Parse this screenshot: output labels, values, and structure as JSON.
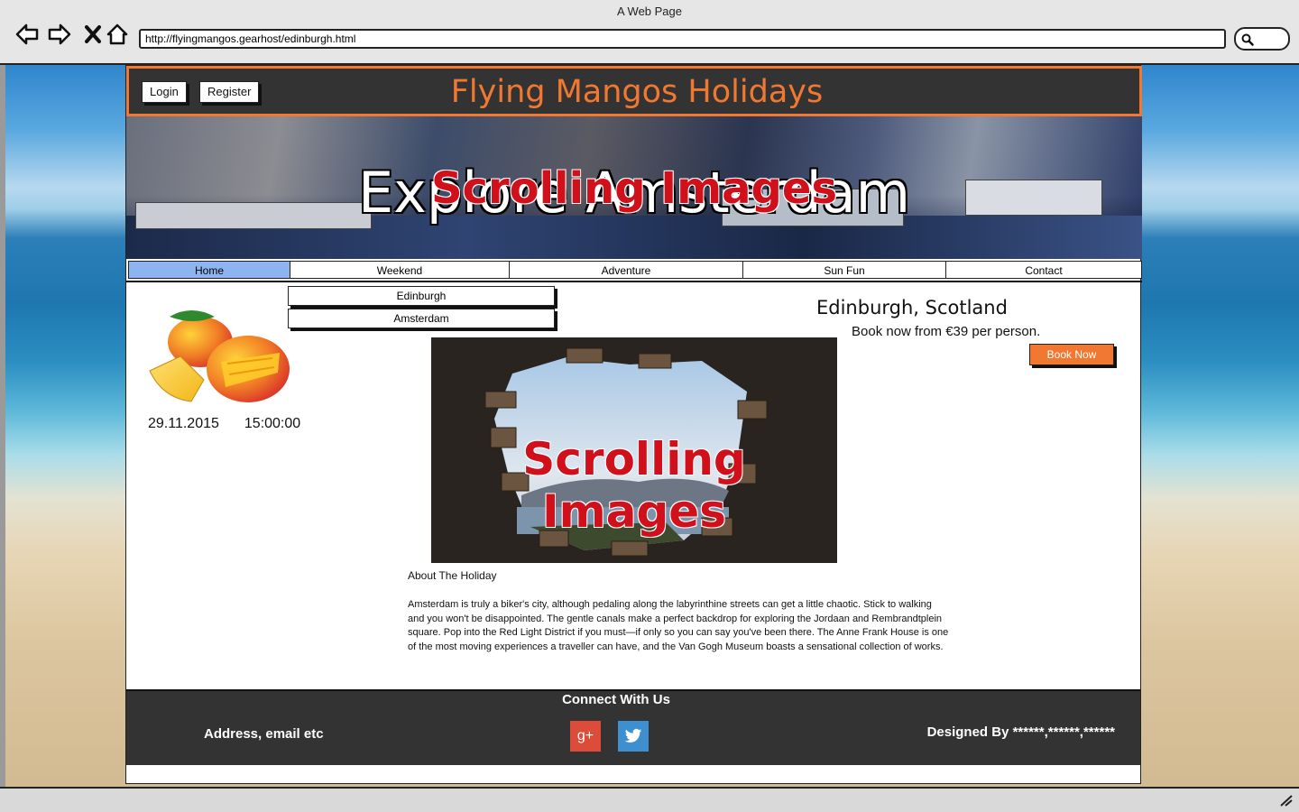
{
  "browser": {
    "window_title": "A Web Page",
    "url": "http://flyingmangos.gearhost/edinburgh.html",
    "icons": [
      "back-arrow-icon",
      "forward-arrow-icon",
      "close-icon",
      "home-icon",
      "search-icon"
    ]
  },
  "header": {
    "login_label": "Login",
    "register_label": "Register",
    "site_title": "Flying Mangos Holidays",
    "accent_color": "#f07830"
  },
  "banner": {
    "title": "Explore Amsterdam",
    "overlay": "Scrolling Images"
  },
  "nav": {
    "items": [
      "Home",
      "Weekend",
      "Adventure",
      "Sun Fun",
      "Contact"
    ],
    "active": "Home",
    "dropdown": [
      "Edinburgh",
      "Amsterdam"
    ]
  },
  "sidebar": {
    "date": "29.11.2015",
    "time": "15:00:00"
  },
  "destination": {
    "title": "Edinburgh, Scotland",
    "subtitle": "Book now from €39 per person.",
    "book_label": "Book Now",
    "image_overlay": "Scrolling Images"
  },
  "about": {
    "heading": "About The Holiday",
    "text": "Amsterdam is truly a biker's city, although pedaling along the labyrinthine streets can get a little chaotic. Stick to walking and you won't be disappointed. The gentle canals make a perfect backdrop for exploring the Jordaan and Rembrandtplein square. Pop into the Red Light District if you must—if only so you can say you've been there. The Anne Frank House is one of the most moving experiences a traveller can have, and the Van Gogh Museum boasts a sensational collection of works."
  },
  "footer": {
    "title": "Connect With Us",
    "left": "Address, email etc",
    "right": "Designed By ******,******,******",
    "google_plus": "g+",
    "google_color": "#dd4b39",
    "twitter_color": "#3d8fd0"
  }
}
